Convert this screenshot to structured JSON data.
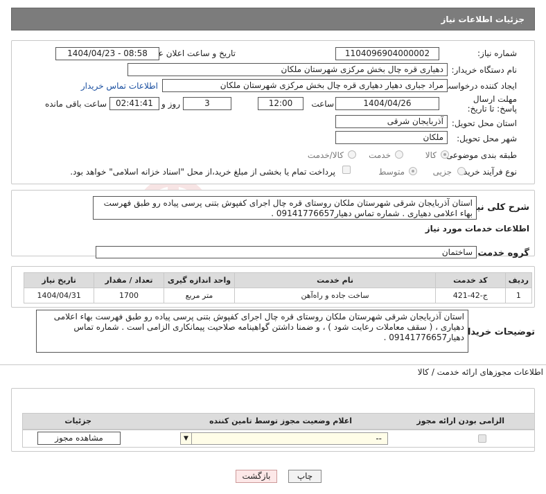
{
  "header": {
    "title": "جزئیات اطلاعات نیاز"
  },
  "form": {
    "need_number_label": "شماره نیاز:",
    "need_number": "1104096904000002",
    "announce_label": "تاریخ و ساعت اعلان عمومی:",
    "announce_value": "1404/04/23 - 08:58",
    "buyer_org_label": "نام دستگاه خریدار:",
    "buyer_org": "دهیاری قره چال بخش مرکزی شهرستان ملکان",
    "creator_label": "ایجاد کننده درخواست:",
    "creator": "مراد جباری دهیار دهیاری قره چال بخش مرکزی شهرستان ملکان",
    "buyer_contact_link": "اطلاعات تماس خریدار",
    "deadline_label": "مهلت ارسال پاسخ: تا تاریخ:",
    "deadline_date": "1404/04/26",
    "time_label": "ساعت",
    "deadline_time": "12:00",
    "days_value": "3",
    "days_label": "روز و",
    "remaining_time": "02:41:41",
    "remaining_label": "ساعت باقی مانده",
    "province_label": "استان محل تحویل:",
    "province": "آذربایجان شرقی",
    "city_label": "شهر محل تحویل:",
    "city": "ملکان",
    "category_label": "طبقه بندی موضوعی:",
    "category_options": [
      "کالا",
      "خدمت",
      "کالا/خدمت"
    ],
    "purchase_type_label": "نوع فرآیند خرید :",
    "purchase_options": [
      "جزیی",
      "متوسط"
    ],
    "payment_note": "پرداخت تمام یا بخشی از مبلغ خرید،از محل \"اسناد خزانه اسلامی\" خواهد بود."
  },
  "summary": {
    "label": "شرح کلی نیاز:",
    "text": "استان آذربایجان شرقی شهرستان ملکان روستای قره چال اجرای کفپوش بتنی پرسی پیاده رو  طبق فهرست بهاء اعلامی دهیاری . شماره تماس دهیار09141776657 ."
  },
  "services": {
    "section_title": "اطلاعات خدمات مورد نیاز",
    "group_label": "گروه خدمت:",
    "group_value": "ساختمان",
    "table_headers": [
      "ردیف",
      "کد خدمت",
      "نام خدمت",
      "واحد اندازه گیری",
      "تعداد / مقدار",
      "تاریخ نیاز"
    ],
    "rows": [
      [
        "1",
        "ج-42-421",
        "ساخت جاده و راه‌آهن",
        "متر مربع",
        "1700",
        "1404/04/31"
      ]
    ]
  },
  "buyer_notes": {
    "label": "توضیحات خریدار:",
    "text": "استان آذربایجان شرقی شهرستان ملکان روستای قره چال اجرای کفپوش بتنی پرسی پیاده رو  طبق فهرست بهاء اعلامی دهیاری ، ( سقف معاملات رعایت شود ) ، و ضمنا داشتن گواهینامه صلاحیت پیمانکاری الزامی است . شماره تماس دهیار09141776657 ."
  },
  "permits": {
    "section_title": "اطلاعات مجوزهای ارائه خدمت / کالا",
    "headers": [
      "الزامی بودن ارائه مجوز",
      "اعلام وضعیت مجوز توسط تامین کننده",
      "جزئیات"
    ],
    "select_value": "--",
    "view_button": "مشاهده مجوز"
  },
  "footer": {
    "print_button": "چاپ",
    "back_button": "بازگشت"
  }
}
